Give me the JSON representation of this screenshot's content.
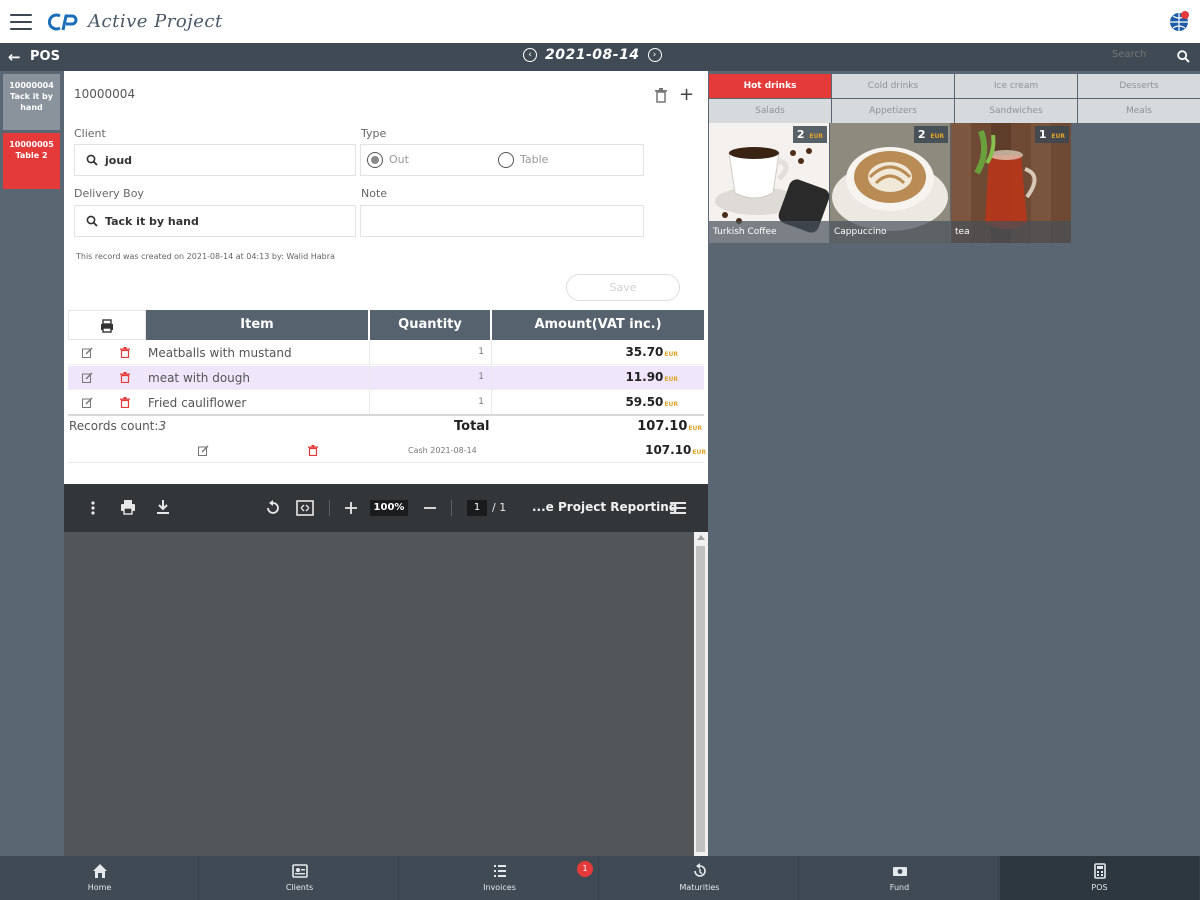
{
  "app": {
    "brand": "Active Project"
  },
  "header": {
    "title": "POS",
    "date": "2021-08-14",
    "search_placeholder": "Search"
  },
  "rail": {
    "tabs": [
      {
        "line1": "10000004",
        "line2": "Tack it by hand",
        "active": false
      },
      {
        "line1": "10000005",
        "line2": "Table 2",
        "active": true
      }
    ]
  },
  "form": {
    "record_id": "10000004",
    "client_label": "Client",
    "client_value": "joud",
    "type_label": "Type",
    "type_options": [
      "Out",
      "Table"
    ],
    "type_selected": "Out",
    "delivery_label": "Delivery Boy",
    "delivery_value": "Tack it by hand",
    "note_label": "Note",
    "note_value": "",
    "created_text": "This record was created on 2021-08-14 at 04:13 by: Walid Habra",
    "save_label": "Save"
  },
  "table": {
    "headers": [
      "Item",
      "Quantity",
      "Amount(VAT inc.)"
    ],
    "rows": [
      {
        "item": "Meatballs with mustand",
        "qty": "1",
        "amount": "35.70",
        "highlight": false
      },
      {
        "item": "meat with dough",
        "qty": "1",
        "amount": "11.90",
        "highlight": true
      },
      {
        "item": "Fried cauliflower",
        "qty": "1",
        "amount": "59.50",
        "highlight": false
      }
    ],
    "currency": "EUR",
    "records_count_label": "Records count:",
    "records_count": "3",
    "total_label": "Total",
    "total_amount": "107.10",
    "payment_text": "Cash 2021-08-14",
    "payment_amount": "107.10"
  },
  "pdf": {
    "zoom": "100%",
    "page": "1",
    "page_total": "/ 1",
    "title": "...e Project Reporting"
  },
  "categories": [
    "Hot drinks",
    "Cold drinks",
    "Ice cream",
    "Desserts",
    "Salads",
    "Appetizers",
    "Sandwiches",
    "Meals"
  ],
  "active_category": "Hot drinks",
  "products": [
    {
      "name": "Turkish Coffee",
      "price": "2",
      "currency": "EUR"
    },
    {
      "name": "Cappuccino",
      "price": "2",
      "currency": "EUR"
    },
    {
      "name": "tea",
      "price": "1",
      "currency": "EUR"
    }
  ],
  "bottom_nav": [
    {
      "label": "Home",
      "icon": "home-icon"
    },
    {
      "label": "Clients",
      "icon": "clients-icon"
    },
    {
      "label": "Invoices",
      "icon": "invoices-icon",
      "badge": "1"
    },
    {
      "label": "Maturities",
      "icon": "maturities-icon"
    },
    {
      "label": "Fund",
      "icon": "fund-icon"
    },
    {
      "label": "POS",
      "icon": "pos-icon",
      "active": true
    }
  ],
  "colors": {
    "accent": "#e53a3a",
    "header": "#3f4a55",
    "panel": "#5a6672",
    "highlight_row": "#efe6fb"
  }
}
